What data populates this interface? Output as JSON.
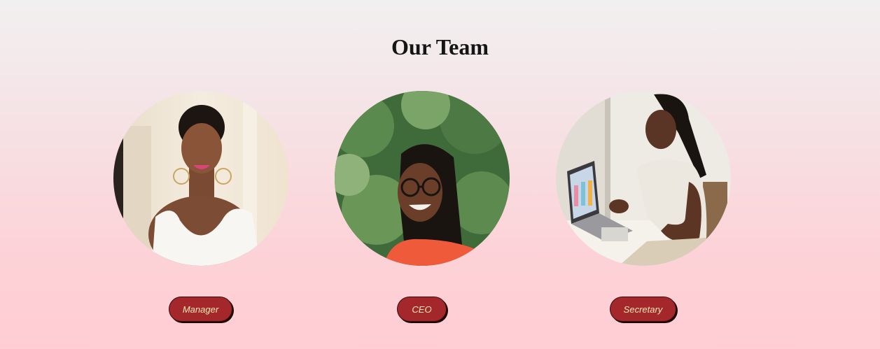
{
  "page": {
    "title": "Our Team"
  },
  "team": [
    {
      "role": "Manager",
      "photo": "smiling woman in white top"
    },
    {
      "role": "CEO",
      "photo": "smiling woman with glasses and orange top"
    },
    {
      "role": "Secretary",
      "photo": "woman working on laptop"
    }
  ],
  "colors": {
    "button_bg": "#a3272b",
    "button_text": "#ffe9b0",
    "title_text": "#151515",
    "bg_top": "#f1f0f0",
    "bg_bottom": "#ffcdd3"
  }
}
